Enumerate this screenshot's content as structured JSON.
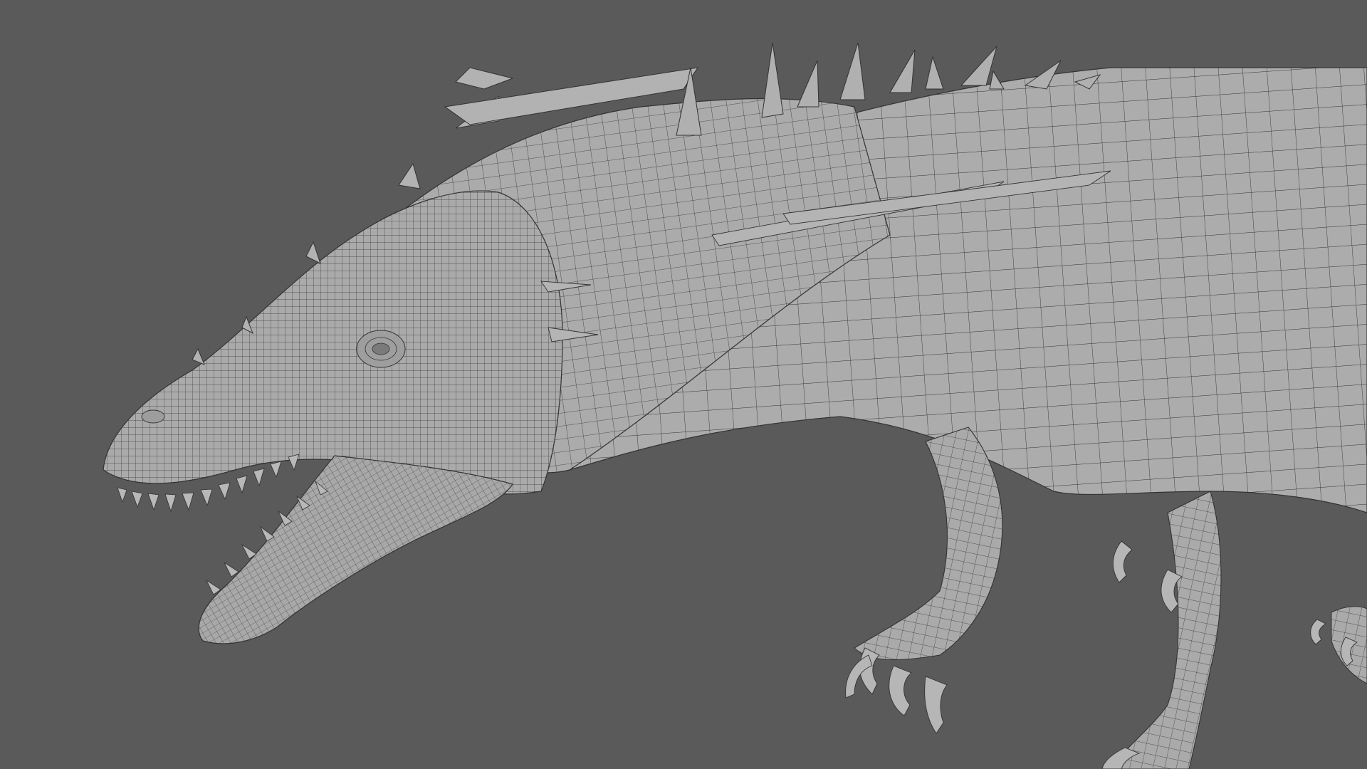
{
  "viewport": {
    "background_color": "#5a5a5a",
    "subject": "dragon-wireframe-mesh",
    "mesh_fill_color": "#a9a9a9",
    "mesh_line_color": "#2e2e2e",
    "mesh_highlight_color": "#bdbdbd"
  }
}
